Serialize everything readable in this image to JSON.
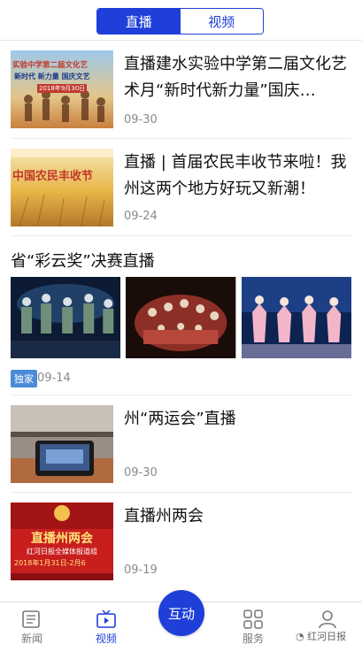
{
  "tabs": {
    "live": "直播",
    "video": "视频"
  },
  "items": [
    {
      "title": "直播建水实验中学第二届文化艺术月“新时代新力量”国庆…",
      "date": "09-30",
      "thumb_text": [
        "实验中学第二届文化艺",
        "新时代 新力量 国庆文艺",
        "2018年9月30日"
      ]
    },
    {
      "title": "直播 | 首届农民丰收节来啦！我州这两个地方好玩又新潮！",
      "date": "09-24",
      "thumb_text": [
        "中国农民丰收节"
      ]
    },
    {
      "title": "州“两运会”直播",
      "date": "09-30"
    },
    {
      "title": "直播州两会",
      "date": "09-19",
      "thumb_text": [
        "直播州两会",
        "红河日报全媒体报道组",
        "2018年1月31日-2月6"
      ]
    }
  ],
  "section": {
    "title": "省“彩云奖”决赛直播",
    "badge": "独家",
    "date": "09-14"
  },
  "bottom_nav": {
    "news": "新闻",
    "video": "视频",
    "interact": "互动",
    "services": "服务",
    "watermark": "红河日报"
  },
  "colors": {
    "accent": "#1f3fd8",
    "badge": "#4a8ad9"
  }
}
